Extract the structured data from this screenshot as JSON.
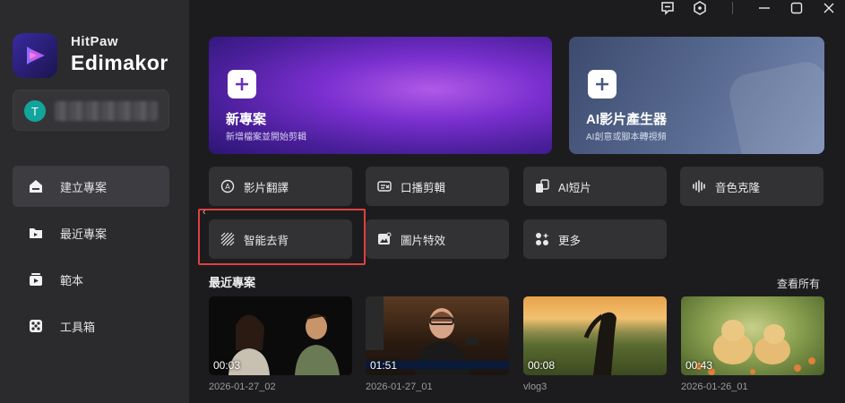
{
  "app": {
    "brand_line1": "HitPaw",
    "brand_line2": "Edimakor"
  },
  "account": {
    "avatar_letter": "T"
  },
  "sidebar": {
    "items": [
      {
        "label": "建立專案",
        "icon": "home-icon",
        "active": true
      },
      {
        "label": "最近專案",
        "icon": "recent-folder-icon",
        "active": false
      },
      {
        "label": "範本",
        "icon": "template-icon",
        "active": false
      },
      {
        "label": "工具箱",
        "icon": "toolbox-icon",
        "active": false
      }
    ]
  },
  "hero": {
    "new_project": {
      "title": "新專案",
      "subtitle": "新增檔案並開始剪輯"
    },
    "ai_video": {
      "title": "AI影片產生器",
      "subtitle": "AI創意或腳本轉視頻"
    }
  },
  "tools": [
    {
      "label": "影片翻譯",
      "icon": "translate-icon"
    },
    {
      "label": "口播剪輯",
      "icon": "speech-edit-icon"
    },
    {
      "label": "AI短片",
      "icon": "ai-short-icon"
    },
    {
      "label": "音色克隆",
      "icon": "voice-clone-icon"
    },
    {
      "label": "智能去背",
      "icon": "background-removal-icon"
    },
    {
      "label": "圖片特效",
      "icon": "image-effect-icon"
    },
    {
      "label": "更多",
      "icon": "more-grid-icon"
    }
  ],
  "recent": {
    "title": "最近專案",
    "see_all": "查看所有",
    "projects": [
      {
        "name": "2026-01-27_02",
        "duration": "00:03"
      },
      {
        "name": "2026-01-27_01",
        "duration": "01:51"
      },
      {
        "name": "vlog3",
        "duration": "00:08"
      },
      {
        "name": "2026-01-26_01",
        "duration": "00:43"
      }
    ]
  },
  "colors": {
    "highlight": "#e0403e",
    "accent_purple": "#7a2fcf",
    "avatar": "#13a49c"
  }
}
